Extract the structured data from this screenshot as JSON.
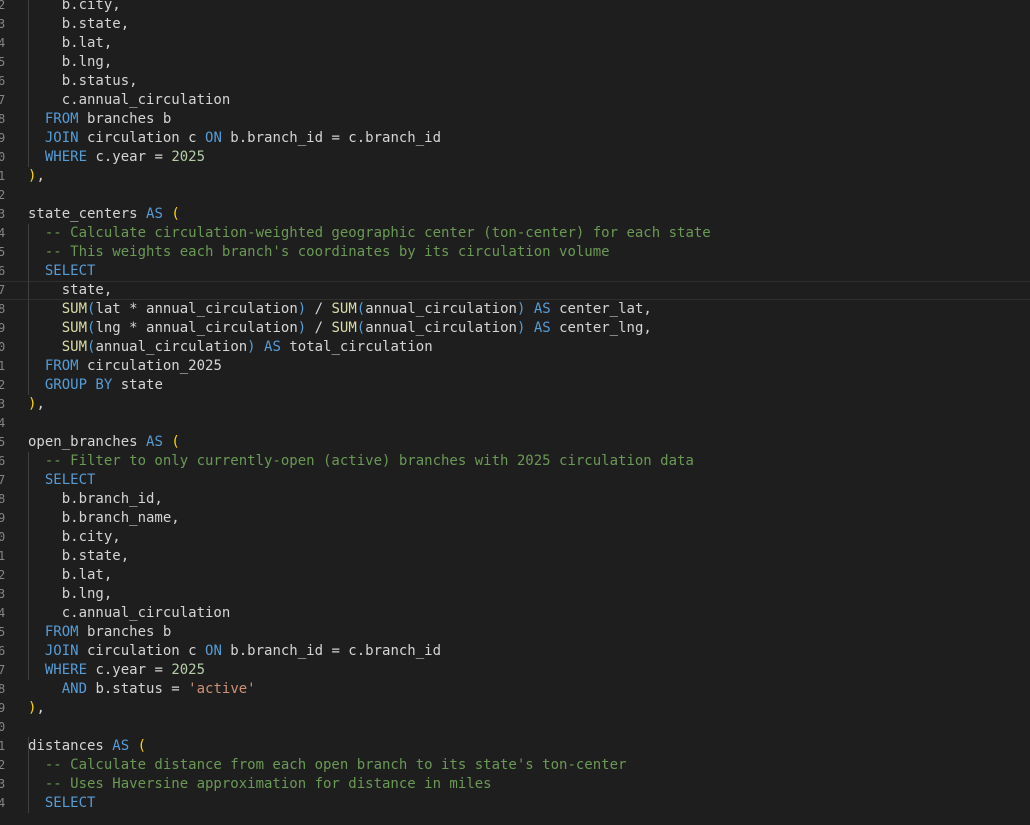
{
  "editor": {
    "language": "sql",
    "theme_colors": {
      "background": "#1e1e1e",
      "text": "#d4d4d4",
      "keyword": "#569cd6",
      "function": "#dcdcaa",
      "number": "#b5cea8",
      "string": "#ce9178",
      "comment": "#6a9955",
      "bracket": "#ffd700"
    },
    "current_line_index": 15,
    "lines": [
      [
        {
          "t": "    b.city,",
          "c": "pl"
        }
      ],
      [
        {
          "t": "    b.state,",
          "c": "pl"
        }
      ],
      [
        {
          "t": "    b.lat,",
          "c": "pl"
        }
      ],
      [
        {
          "t": "    b.lng,",
          "c": "pl"
        }
      ],
      [
        {
          "t": "    b.status,",
          "c": "pl"
        }
      ],
      [
        {
          "t": "    c.annual_circulation",
          "c": "pl"
        }
      ],
      [
        {
          "t": "  ",
          "c": "pl"
        },
        {
          "t": "FROM",
          "c": "kw"
        },
        {
          "t": " branches b",
          "c": "pl"
        }
      ],
      [
        {
          "t": "  ",
          "c": "pl"
        },
        {
          "t": "JOIN",
          "c": "kw"
        },
        {
          "t": " circulation c ",
          "c": "pl"
        },
        {
          "t": "ON",
          "c": "kw"
        },
        {
          "t": " b.branch_id = c.branch_id",
          "c": "pl"
        }
      ],
      [
        {
          "t": "  ",
          "c": "pl"
        },
        {
          "t": "WHERE",
          "c": "kw"
        },
        {
          "t": " c.year = ",
          "c": "pl"
        },
        {
          "t": "2025",
          "c": "num"
        }
      ],
      [
        {
          "t": ")",
          "c": "pn"
        },
        {
          "t": ",",
          "c": "pl"
        }
      ],
      [],
      [
        {
          "t": "state_centers ",
          "c": "pl"
        },
        {
          "t": "AS",
          "c": "kw"
        },
        {
          "t": " ",
          "c": "pl"
        },
        {
          "t": "(",
          "c": "pn"
        }
      ],
      [
        {
          "t": "  -- Calculate circulation-weighted geographic center (ton-center) for each state",
          "c": "cm"
        }
      ],
      [
        {
          "t": "  -- This weights each branch's coordinates by its circulation volume",
          "c": "cm"
        }
      ],
      [
        {
          "t": "  ",
          "c": "pl"
        },
        {
          "t": "SELECT",
          "c": "kw"
        }
      ],
      [
        {
          "t": "    state,",
          "c": "pl"
        }
      ],
      [
        {
          "t": "    ",
          "c": "pl"
        },
        {
          "t": "SUM",
          "c": "fn"
        },
        {
          "t": "(",
          "c": "kw"
        },
        {
          "t": "lat * annual_circulation",
          "c": "pl"
        },
        {
          "t": ")",
          "c": "kw"
        },
        {
          "t": " / ",
          "c": "pl"
        },
        {
          "t": "SUM",
          "c": "fn"
        },
        {
          "t": "(",
          "c": "kw"
        },
        {
          "t": "annual_circulation",
          "c": "pl"
        },
        {
          "t": ")",
          "c": "kw"
        },
        {
          "t": " ",
          "c": "pl"
        },
        {
          "t": "AS",
          "c": "kw"
        },
        {
          "t": " center_lat,",
          "c": "pl"
        }
      ],
      [
        {
          "t": "    ",
          "c": "pl"
        },
        {
          "t": "SUM",
          "c": "fn"
        },
        {
          "t": "(",
          "c": "kw"
        },
        {
          "t": "lng * annual_circulation",
          "c": "pl"
        },
        {
          "t": ")",
          "c": "kw"
        },
        {
          "t": " / ",
          "c": "pl"
        },
        {
          "t": "SUM",
          "c": "fn"
        },
        {
          "t": "(",
          "c": "kw"
        },
        {
          "t": "annual_circulation",
          "c": "pl"
        },
        {
          "t": ")",
          "c": "kw"
        },
        {
          "t": " ",
          "c": "pl"
        },
        {
          "t": "AS",
          "c": "kw"
        },
        {
          "t": " center_lng,",
          "c": "pl"
        }
      ],
      [
        {
          "t": "    ",
          "c": "pl"
        },
        {
          "t": "SUM",
          "c": "fn"
        },
        {
          "t": "(",
          "c": "kw"
        },
        {
          "t": "annual_circulation",
          "c": "pl"
        },
        {
          "t": ")",
          "c": "kw"
        },
        {
          "t": " ",
          "c": "pl"
        },
        {
          "t": "AS",
          "c": "kw"
        },
        {
          "t": " total_circulation",
          "c": "pl"
        }
      ],
      [
        {
          "t": "  ",
          "c": "pl"
        },
        {
          "t": "FROM",
          "c": "kw"
        },
        {
          "t": " circulation_2025",
          "c": "pl"
        }
      ],
      [
        {
          "t": "  ",
          "c": "pl"
        },
        {
          "t": "GROUP BY",
          "c": "kw"
        },
        {
          "t": " state",
          "c": "pl"
        }
      ],
      [
        {
          "t": ")",
          "c": "pn"
        },
        {
          "t": ",",
          "c": "pl"
        }
      ],
      [],
      [
        {
          "t": "open_branches ",
          "c": "pl"
        },
        {
          "t": "AS",
          "c": "kw"
        },
        {
          "t": " ",
          "c": "pl"
        },
        {
          "t": "(",
          "c": "pn"
        }
      ],
      [
        {
          "t": "  -- Filter to only currently-open (active) branches with 2025 circulation data",
          "c": "cm"
        }
      ],
      [
        {
          "t": "  ",
          "c": "pl"
        },
        {
          "t": "SELECT",
          "c": "kw"
        }
      ],
      [
        {
          "t": "    b.branch_id,",
          "c": "pl"
        }
      ],
      [
        {
          "t": "    b.branch_name,",
          "c": "pl"
        }
      ],
      [
        {
          "t": "    b.city,",
          "c": "pl"
        }
      ],
      [
        {
          "t": "    b.state,",
          "c": "pl"
        }
      ],
      [
        {
          "t": "    b.lat,",
          "c": "pl"
        }
      ],
      [
        {
          "t": "    b.lng,",
          "c": "pl"
        }
      ],
      [
        {
          "t": "    c.annual_circulation",
          "c": "pl"
        }
      ],
      [
        {
          "t": "  ",
          "c": "pl"
        },
        {
          "t": "FROM",
          "c": "kw"
        },
        {
          "t": " branches b",
          "c": "pl"
        }
      ],
      [
        {
          "t": "  ",
          "c": "pl"
        },
        {
          "t": "JOIN",
          "c": "kw"
        },
        {
          "t": " circulation c ",
          "c": "pl"
        },
        {
          "t": "ON",
          "c": "kw"
        },
        {
          "t": " b.branch_id = c.branch_id",
          "c": "pl"
        }
      ],
      [
        {
          "t": "  ",
          "c": "pl"
        },
        {
          "t": "WHERE",
          "c": "kw"
        },
        {
          "t": " c.year = ",
          "c": "pl"
        },
        {
          "t": "2025",
          "c": "num"
        }
      ],
      [
        {
          "t": "    ",
          "c": "pl"
        },
        {
          "t": "AND",
          "c": "kw"
        },
        {
          "t": " b.status = ",
          "c": "pl"
        },
        {
          "t": "'active'",
          "c": "str"
        }
      ],
      [
        {
          "t": ")",
          "c": "pn"
        },
        {
          "t": ",",
          "c": "pl"
        }
      ],
      [],
      [
        {
          "t": "distances ",
          "c": "pl"
        },
        {
          "t": "AS",
          "c": "kw"
        },
        {
          "t": " ",
          "c": "pl"
        },
        {
          "t": "(",
          "c": "pn"
        }
      ],
      [
        {
          "t": "  -- Calculate distance from each open branch to its state's ton-center",
          "c": "cm"
        }
      ],
      [
        {
          "t": "  -- Uses Haversine approximation for distance in miles",
          "c": "cm"
        }
      ],
      [
        {
          "t": "  ",
          "c": "pl"
        },
        {
          "t": "SELECT",
          "c": "kw"
        }
      ]
    ]
  }
}
